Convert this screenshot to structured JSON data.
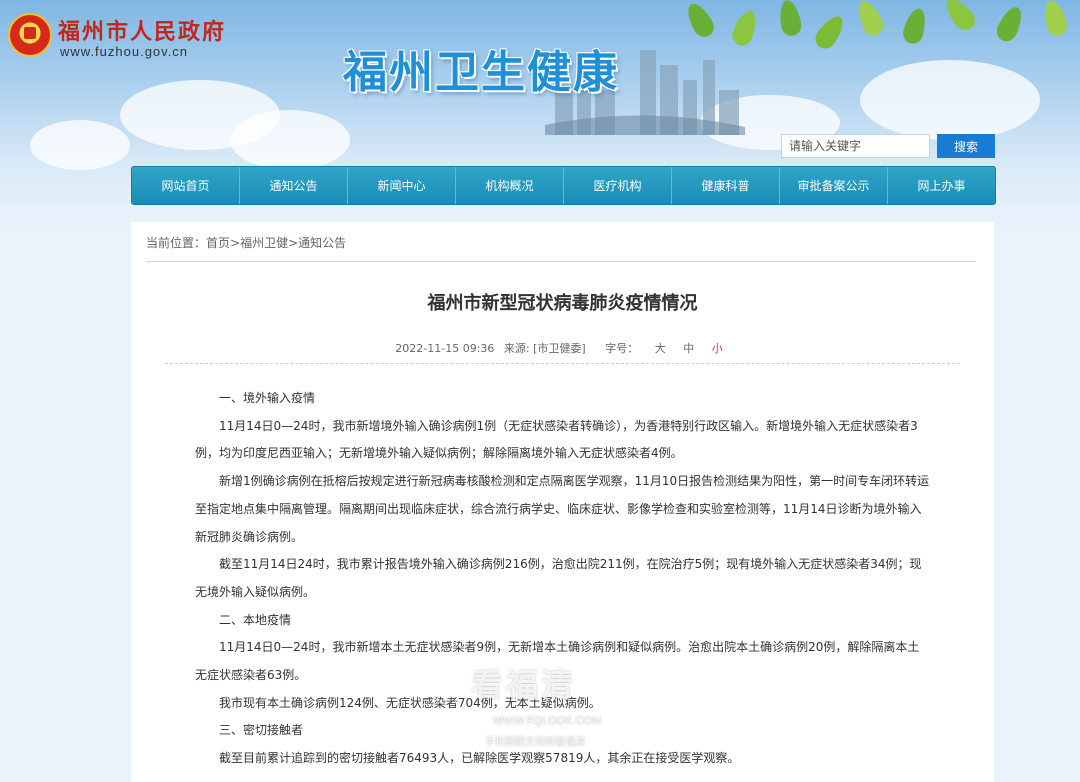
{
  "header": {
    "gov_name": "福州市人民政府",
    "gov_url": "www.fuzhou.gov.cn",
    "site_title": "福州卫生健康",
    "search_placeholder": "请输入关键字",
    "search_button": "搜索"
  },
  "nav": {
    "items": [
      {
        "label": "网站首页"
      },
      {
        "label": "通知公告"
      },
      {
        "label": "新闻中心"
      },
      {
        "label": "机构概况"
      },
      {
        "label": "医疗机构"
      },
      {
        "label": "健康科普"
      },
      {
        "label": "审批备案公示"
      },
      {
        "label": "网上办事"
      }
    ]
  },
  "breadcrumb": {
    "prefix": "当前位置：",
    "items": [
      "首页",
      "福州卫健",
      "通知公告"
    ],
    "sep": ">"
  },
  "article": {
    "title": "福州市新型冠状病毒肺炎疫情情况",
    "date": "2022-11-15 09:36",
    "source": "来源: [市卫健委]",
    "font_label": "字号：",
    "font_sizes": [
      "大",
      "中",
      "小"
    ],
    "paragraphs": [
      "一、境外输入疫情",
      "11月14日0—24时，我市新增境外输入确诊病例1例（无症状感染者转确诊），为香港特别行政区输入。新增境外输入无症状感染者3例，均为印度尼西亚输入；无新增境外输入疑似病例；解除隔离境外输入无症状感染者4例。",
      "新增1例确诊病例在抵榕后按规定进行新冠病毒核酸检测和定点隔离医学观察，11月10日报告检测结果为阳性，第一时间专车闭环转运至指定地点集中隔离管理。隔离期间出现临床症状，综合流行病学史、临床症状、影像学检查和实验室检测等，11月14日诊断为境外输入新冠肺炎确诊病例。",
      "截至11月14日24时，我市累计报告境外输入确诊病例216例，治愈出院211例，在院治疗5例；现有境外输入无症状感染者34例；现无境外输入疑似病例。",
      "二、本地疫情",
      "11月14日0—24时，我市新增本土无症状感染者9例，无新增本土确诊病例和疑似病例。治愈出院本土确诊病例20例，解除隔离本土无症状感染者63例。",
      "我市现有本土确诊病例124例、无症状感染者704例，无本土疑似病例。",
      "三、密切接触者",
      "截至目前累计追踪到的密切接触者76493人，已解除医学观察57819人，其余正在接受医学观察。"
    ]
  },
  "watermark": {
    "brand": "看福清",
    "url": "WWW.FQLOOK.COM",
    "line": "手机版图文视频看福清"
  },
  "colors": {
    "nav_bg": "#1a8cb6",
    "search_button": "#1a7bd3",
    "site_title": "#1f8fd6",
    "gov_name": "#c0281c",
    "active_font_size": "#d9431f"
  }
}
